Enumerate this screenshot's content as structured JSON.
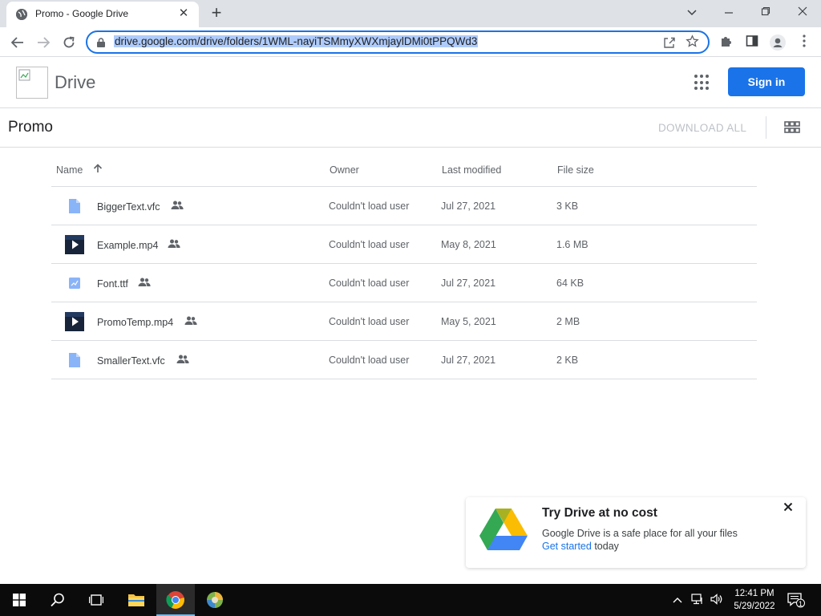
{
  "browser": {
    "tab_title": "Promo - Google Drive",
    "tab_close": "✕",
    "new_tab": "+",
    "url": "drive.google.com/drive/folders/1WML-nayiTSMmyXWXmjaylDMi0tPPQWd3"
  },
  "drive": {
    "app_name": "Drive",
    "sign_in_label": "Sign in"
  },
  "folder": {
    "title": "Promo",
    "download_all_label": "DOWNLOAD ALL"
  },
  "table": {
    "headers": {
      "name": "Name",
      "owner": "Owner",
      "last_modified": "Last modified",
      "file_size": "File size"
    },
    "rows": [
      {
        "name": "BiggerText.vfc",
        "type": "doc-icon",
        "owner": "Couldn't load user",
        "modified": "Jul 27, 2021",
        "size": "3 KB"
      },
      {
        "name": "Example.mp4",
        "type": "video-thumbnail",
        "owner": "Couldn't load user",
        "modified": "May 8, 2021",
        "size": "1.6 MB"
      },
      {
        "name": "Font.ttf",
        "type": "image-icon",
        "owner": "Couldn't load user",
        "modified": "Jul 27, 2021",
        "size": "64 KB"
      },
      {
        "name": "PromoTemp.mp4",
        "type": "video-thumbnail",
        "owner": "Couldn't load user",
        "modified": "May 5, 2021",
        "size": "2 MB"
      },
      {
        "name": "SmallerText.vfc",
        "type": "doc-icon",
        "owner": "Couldn't load user",
        "modified": "Jul 27, 2021",
        "size": "2 KB"
      }
    ]
  },
  "promo": {
    "title": "Try Drive at no cost",
    "body": "Google Drive is a safe place for all your files",
    "link_label": "Get started",
    "link_suffix": " today"
  },
  "taskbar": {
    "time": "12:41 PM",
    "date": "5/29/2022",
    "notification_count": "1"
  },
  "colors": {
    "accent": "#1a73e8",
    "url_highlight": "#aecbfa"
  }
}
